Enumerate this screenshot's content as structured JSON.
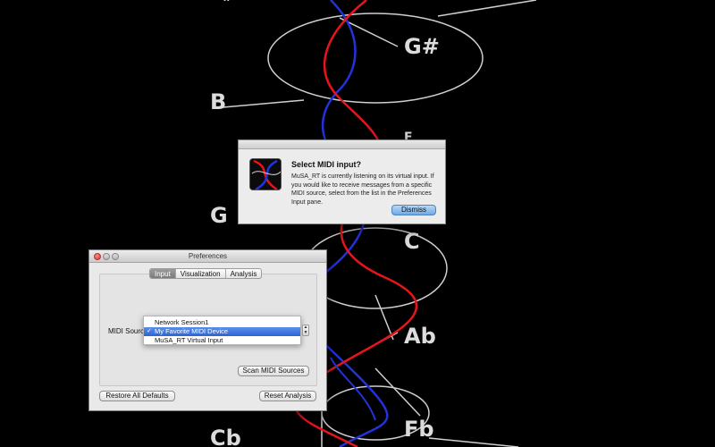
{
  "background": {
    "note_labels": [
      "G#",
      "B",
      "E",
      "G",
      "C",
      "Ab",
      "Fb",
      "Cb",
      "#"
    ],
    "colors": {
      "red": "#e8141b",
      "blue": "#2233dd",
      "gray": "#cfcfcf"
    }
  },
  "alert": {
    "title": "Select MIDI input?",
    "message": "MuSA_RT is currently listening on its virtual input.  If you would like to receive messages from a specific MIDI source, select from the list in the Preferences Input pane.",
    "dismiss_label": "Dismiss",
    "icon": "musa-rt-app-icon"
  },
  "preferences": {
    "window_title": "Preferences",
    "tabs": [
      {
        "label": "Input",
        "active": true
      },
      {
        "label": "Visualization",
        "active": false
      },
      {
        "label": "Analysis",
        "active": false
      }
    ],
    "midi_source_label": "MIDI Source",
    "midi_sources": [
      {
        "label": "Network Session1",
        "selected": false
      },
      {
        "label": "My Favorite MIDI Device",
        "selected": true
      },
      {
        "label": "MuSA_RT Virtual Input",
        "selected": false
      }
    ],
    "check_mark": "✓",
    "scan_button": "Scan MIDI Sources",
    "restore_button": "Restore All Defaults",
    "reset_button": "Reset Analysis",
    "traffic_lights": [
      "close",
      "minimize",
      "zoom"
    ]
  }
}
